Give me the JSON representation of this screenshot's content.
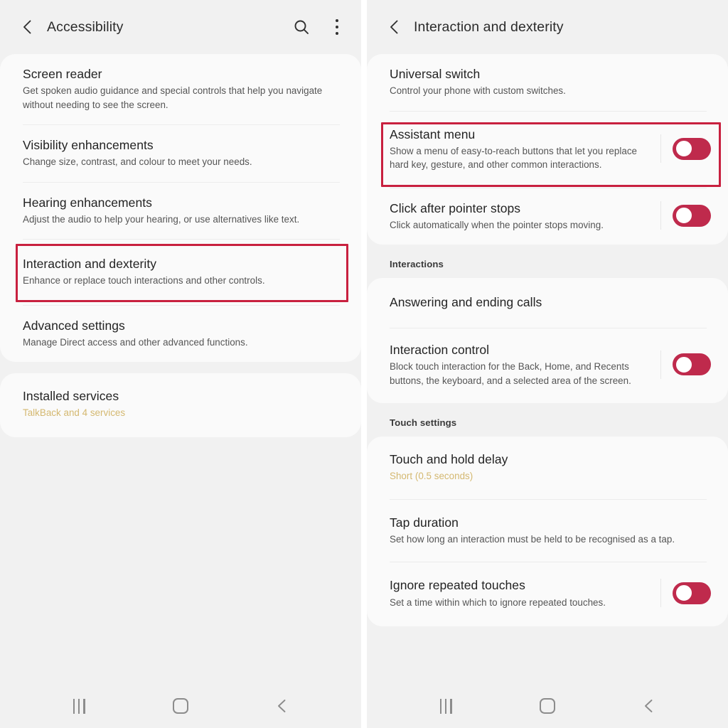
{
  "left_screen": {
    "header": {
      "back_icon": "back-chevron-icon",
      "title": "Accessibility",
      "search_icon": "search-icon",
      "more_icon": "more-options-icon"
    },
    "card1": [
      {
        "title": "Screen reader",
        "subtitle": "Get spoken audio guidance and special controls that help you navigate without needing to see the screen."
      },
      {
        "title": "Visibility enhancements",
        "subtitle": "Change size, contrast, and colour to meet your needs."
      },
      {
        "title": "Hearing enhancements",
        "subtitle": "Adjust the audio to help your hearing, or use alternatives like text."
      },
      {
        "title": "Interaction and dexterity",
        "subtitle": "Enhance or replace touch interactions and other controls.",
        "highlighted": true
      },
      {
        "title": "Advanced settings",
        "subtitle": "Manage Direct access and other advanced functions."
      }
    ],
    "card2": [
      {
        "title": "Installed services",
        "subtitle": "TalkBack and 4 services",
        "subtitle_accent": true
      }
    ]
  },
  "right_screen": {
    "header": {
      "back_icon": "back-chevron-icon",
      "title": "Interaction and dexterity"
    },
    "card1": [
      {
        "title": "Universal switch",
        "subtitle": "Control your phone with custom switches."
      },
      {
        "title": "Assistant menu",
        "subtitle": "Show a menu of easy-to-reach buttons that let you replace hard key, gesture, and other common interactions.",
        "toggle": "off",
        "highlighted": true
      },
      {
        "title": "Click after pointer stops",
        "subtitle": "Click automatically when the pointer stops moving.",
        "toggle": "off"
      }
    ],
    "section1_label": "Interactions",
    "card2": [
      {
        "title": "Answering and ending calls",
        "subtitle": ""
      },
      {
        "title": "Interaction control",
        "subtitle": "Block touch interaction for the Back, Home, and Recents buttons, the keyboard, and a selected area of the screen.",
        "toggle": "off"
      }
    ],
    "section2_label": "Touch settings",
    "card3": [
      {
        "title": "Touch and hold delay",
        "subtitle": "Short (0.5 seconds)",
        "subtitle_accent": true
      },
      {
        "title": "Tap duration",
        "subtitle": "Set how long an interaction must be held to be recognised as a tap."
      },
      {
        "title": "Ignore repeated touches",
        "subtitle": "Set a time within which to ignore repeated touches.",
        "toggle": "off"
      }
    ]
  },
  "navbar": {
    "recents_icon": "recents-icon",
    "home_icon": "home-icon",
    "back_icon": "back-icon"
  },
  "colors": {
    "page_background": "#f1f1f1",
    "card_background": "#fafafa",
    "highlight_border": "#c8203f",
    "toggle_accent": "#bf2a4c",
    "subtitle_accent": "#d4b870",
    "title_text": "#232323"
  }
}
